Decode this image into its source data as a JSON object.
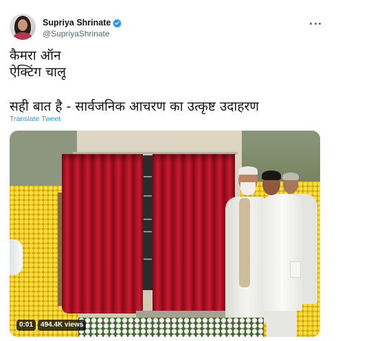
{
  "tweet": {
    "author": {
      "name": "Supriya Shrinate",
      "handle": "@SupriyaShrinate",
      "verified": true,
      "avatar_icon": "avatar",
      "verified_icon": "verified-badge-icon"
    },
    "more_icon": "more-options-icon",
    "text": {
      "line1": "कैमरा ऑन",
      "line2": "ऐक्टिंग चालू",
      "line3": "सही बात है - सार्वजनिक आचरण का उत्कृष्ट उदाहरण"
    },
    "translate_label": "Translate Tweet",
    "media": {
      "type": "video",
      "duration": "0:01",
      "views": "494.4K views"
    }
  },
  "colors": {
    "text": "#0f1419",
    "handle": "#536471",
    "link": "#1d9bf0",
    "verified": "#1d9bf0",
    "curtain": "#b5142a",
    "marigold": "#f2d12a"
  }
}
